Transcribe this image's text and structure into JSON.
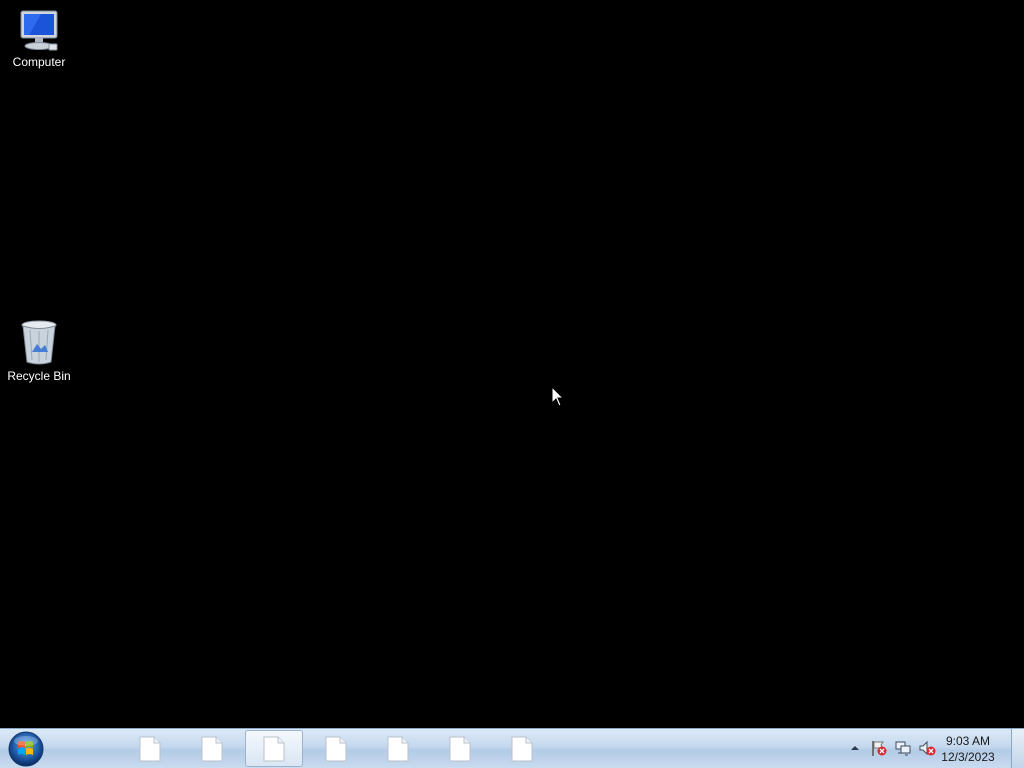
{
  "desktop": {
    "icons": [
      {
        "label": "Computer",
        "icon": "computer-icon"
      },
      {
        "label": "Recycle Bin",
        "icon": "recycle-bin-icon"
      }
    ]
  },
  "taskbar": {
    "start_icon": "windows-start-orb-icon",
    "buttons": [
      {
        "icon": "document-icon",
        "active": false
      },
      {
        "icon": "document-icon",
        "active": false
      },
      {
        "icon": "document-icon",
        "active": true
      },
      {
        "icon": "document-icon",
        "active": false
      },
      {
        "icon": "document-icon",
        "active": false
      },
      {
        "icon": "document-icon",
        "active": false
      },
      {
        "icon": "document-icon",
        "active": false
      }
    ],
    "tray": {
      "icons": [
        "show-hidden-icons-arrow-icon",
        "action-center-flag-error-icon",
        "network-icon",
        "volume-muted-icon"
      ],
      "time": "9:03 AM",
      "date": "12/3/2023"
    }
  },
  "colors": {
    "desktop_background": "#000000",
    "taskbar_light": "#dce9f7",
    "taskbar_dark": "#b3cbe6"
  }
}
